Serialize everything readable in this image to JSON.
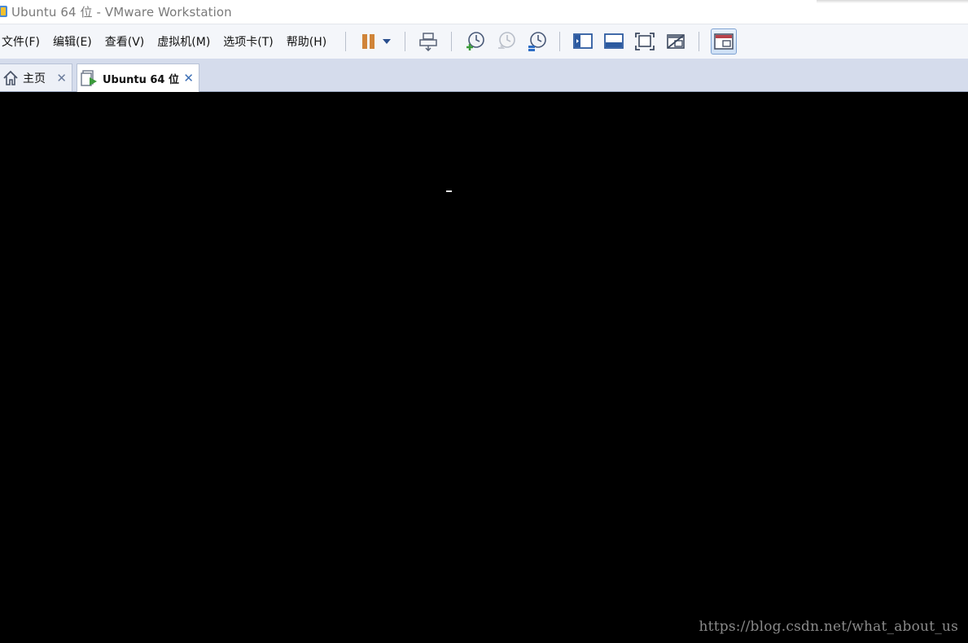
{
  "window": {
    "title": "Ubuntu 64 位 - VMware Workstation"
  },
  "menu": {
    "items": [
      "文件(F)",
      "编辑(E)",
      "查看(V)",
      "虚拟机(M)",
      "选项卡(T)",
      "帮助(H)"
    ]
  },
  "toolbar": {
    "icons": [
      "pause-icon",
      "dropdown-arrow-icon",
      "send-ctrl-alt-del-icon",
      "snapshot-take-icon",
      "snapshot-revert-icon",
      "snapshot-manager-icon",
      "show-library-icon",
      "show-thumbnail-bar-icon",
      "full-screen-icon",
      "unity-icon",
      "console-view-icon"
    ],
    "accent": "#c77a2f"
  },
  "tabs": [
    {
      "label": "主页",
      "icon": "home-icon",
      "active": false
    },
    {
      "label": "Ubuntu 64 位",
      "icon": "vm-running-icon",
      "active": true
    }
  ],
  "console": {
    "background": "#000000"
  },
  "watermark": "https://blog.csdn.net/what_about_us"
}
